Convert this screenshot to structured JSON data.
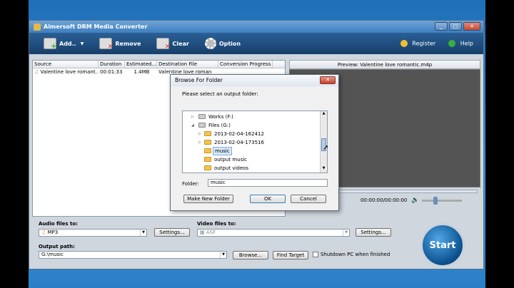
{
  "window": {
    "title": "Aimersoft DRM Media Converter"
  },
  "toolbar": {
    "add_label": "Add..",
    "remove_label": "Remove",
    "clear_label": "Clear",
    "option_label": "Option",
    "register_label": "Register",
    "help_label": "Help"
  },
  "table": {
    "headers": [
      "Source",
      "Duration",
      "Estimated...",
      "Destination File",
      "Conversion Progress"
    ],
    "rows": [
      {
        "source": "Valentine love romant...",
        "duration": "00:01:33",
        "size": "1.4MB",
        "dest": "Valentine love roman"
      }
    ]
  },
  "preview": {
    "title": "Preview: Valentine love romantic.m4p",
    "time": "00:00:00/00:00:00"
  },
  "bottom": {
    "audio_label": "Audio files to:",
    "audio_value": "MP3",
    "audio_settings": "Settings...",
    "video_label": "Video files to:",
    "video_value": "ASF",
    "video_settings": "Settings...",
    "output_label": "Output path:",
    "output_value": "G:\\music",
    "browse": "Browse...",
    "find_target": "Find Target",
    "shutdown": "Shutdown PC when finished",
    "start": "Start"
  },
  "dialog": {
    "title": "Browse For Folder",
    "prompt": "Please select an output folder:",
    "tree": [
      {
        "label": "Works (F:)",
        "type": "drive",
        "level": 0,
        "expander": "▷"
      },
      {
        "label": "Files (G:)",
        "type": "drive",
        "level": 0,
        "expander": "◢"
      },
      {
        "label": "2013-02-04-162412",
        "type": "folder",
        "level": 1,
        "expander": "▷"
      },
      {
        "label": "2013-02-04-173516",
        "type": "folder",
        "level": 1,
        "expander": "▷"
      },
      {
        "label": "music",
        "type": "folder",
        "level": 1,
        "expander": "",
        "selected": true
      },
      {
        "label": "output music",
        "type": "folder",
        "level": 1,
        "expander": ""
      },
      {
        "label": "output videos",
        "type": "folder",
        "level": 1,
        "expander": ""
      }
    ],
    "folder_label": "Folder:",
    "folder_value": "music",
    "make_new_folder": "Make New Folder",
    "ok": "OK",
    "cancel": "Cancel"
  }
}
